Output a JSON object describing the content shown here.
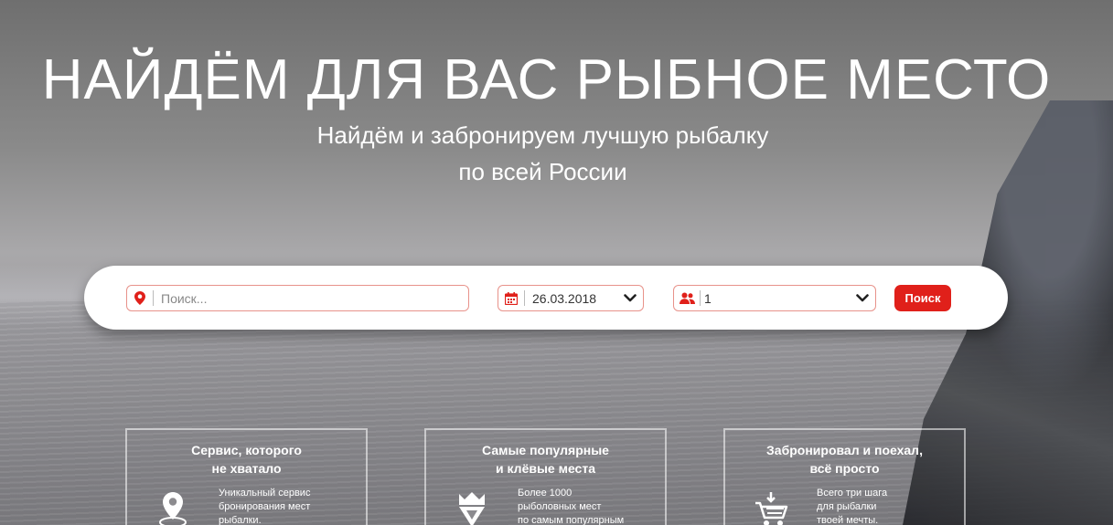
{
  "hero": {
    "title": "НАЙДЁМ ДЛЯ ВАС РЫБНОЕ МЕСТО",
    "subtitle_line1": "Найдём и забронируем лучшую рыбалку",
    "subtitle_line2": "по всей России"
  },
  "search": {
    "location_placeholder": "Поиск...",
    "location_icon": "map-pin-icon",
    "date_value": "26.03.2018",
    "date_icon": "calendar-icon",
    "guests_value": "1",
    "guests_icon": "people-icon",
    "button_label": "Поиск"
  },
  "features": [
    {
      "title": "Сервис, которого\nне хватало",
      "icon": "location-pin-icon",
      "text": "Уникальный сервис\nбронирования мест\nрыбалки."
    },
    {
      "title": "Самые популярные\nи клёвые места",
      "icon": "badge-icon",
      "text": "Более 1000\nрыболовных мест\nпо самым популярным"
    },
    {
      "title": "Забронировал и поехал,\nвсё просто",
      "icon": "cart-icon",
      "text": "Всего три шага\nдля рыбалки\nтвоей мечты."
    }
  ],
  "colors": {
    "accent": "#e0201a",
    "field_border": "#e8928a"
  }
}
